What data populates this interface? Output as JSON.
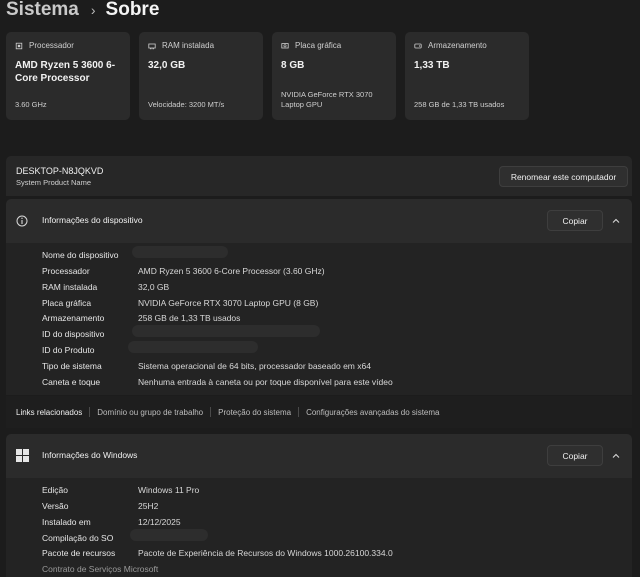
{
  "breadcrumb": {
    "parent": "Sistema",
    "separator": "›",
    "current": "Sobre"
  },
  "cards": [
    {
      "label": "Processador",
      "value": "AMD Ryzen 5 3600 6-Core Processor",
      "detail": "3.60 GHz",
      "icon": "processor-icon"
    },
    {
      "label": "RAM instalada",
      "value": "32,0 GB",
      "detail": "Velocidade: 3200 MT/s",
      "icon": "ram-icon"
    },
    {
      "label": "Placa gráfica",
      "value": "8 GB",
      "detail": "NVIDIA GeForce RTX 3070 Laptop GPU",
      "icon": "gpu-icon"
    },
    {
      "label": "Armazenamento",
      "value": "1,33 TB",
      "detail": "258 GB de 1,33 TB usados",
      "icon": "storage-icon"
    }
  ],
  "computer": {
    "name": "DESKTOP-N8JQKVD",
    "subtitle": "System Product Name",
    "rename_label": "Renomear este computador"
  },
  "device_info": {
    "title": "Informações do dispositivo",
    "copy_label": "Copiar",
    "rows": [
      {
        "key": "Nome do dispositivo",
        "value": ""
      },
      {
        "key": "Processador",
        "value": "AMD Ryzen 5 3600 6-Core Processor (3.60 GHz)"
      },
      {
        "key": "RAM instalada",
        "value": "32,0 GB"
      },
      {
        "key": "Placa gráfica",
        "value": "NVIDIA GeForce RTX 3070 Laptop GPU (8 GB)"
      },
      {
        "key": "Armazenamento",
        "value": "258 GB de 1,33 TB usados"
      },
      {
        "key": "ID do dispositivo",
        "value": ""
      },
      {
        "key": "ID do Produto",
        "value": ""
      },
      {
        "key": "Tipo de sistema",
        "value": "Sistema operacional de 64 bits, processador baseado em x64"
      },
      {
        "key": "Caneta e toque",
        "value": "Nenhuma entrada à caneta ou por toque disponível para este vídeo"
      }
    ]
  },
  "related": {
    "label": "Links relacionados",
    "links": [
      "Domínio ou grupo de trabalho",
      "Proteção do sistema",
      "Configurações avançadas do sistema"
    ]
  },
  "windows_info": {
    "title": "Informações do Windows",
    "copy_label": "Copiar",
    "rows": [
      {
        "key": "Edição",
        "value": "Windows 11 Pro"
      },
      {
        "key": "Versão",
        "value": "25H2"
      },
      {
        "key": "Instalado em",
        "value": "12/12/2025"
      },
      {
        "key": "Compilação do SO",
        "value": ""
      },
      {
        "key": "Pacote de recursos",
        "value": "Pacote de Experiência de Recursos do Windows 1000.26100.334.0"
      }
    ],
    "partial_row": "Contrato de Serviços Microsoft"
  }
}
